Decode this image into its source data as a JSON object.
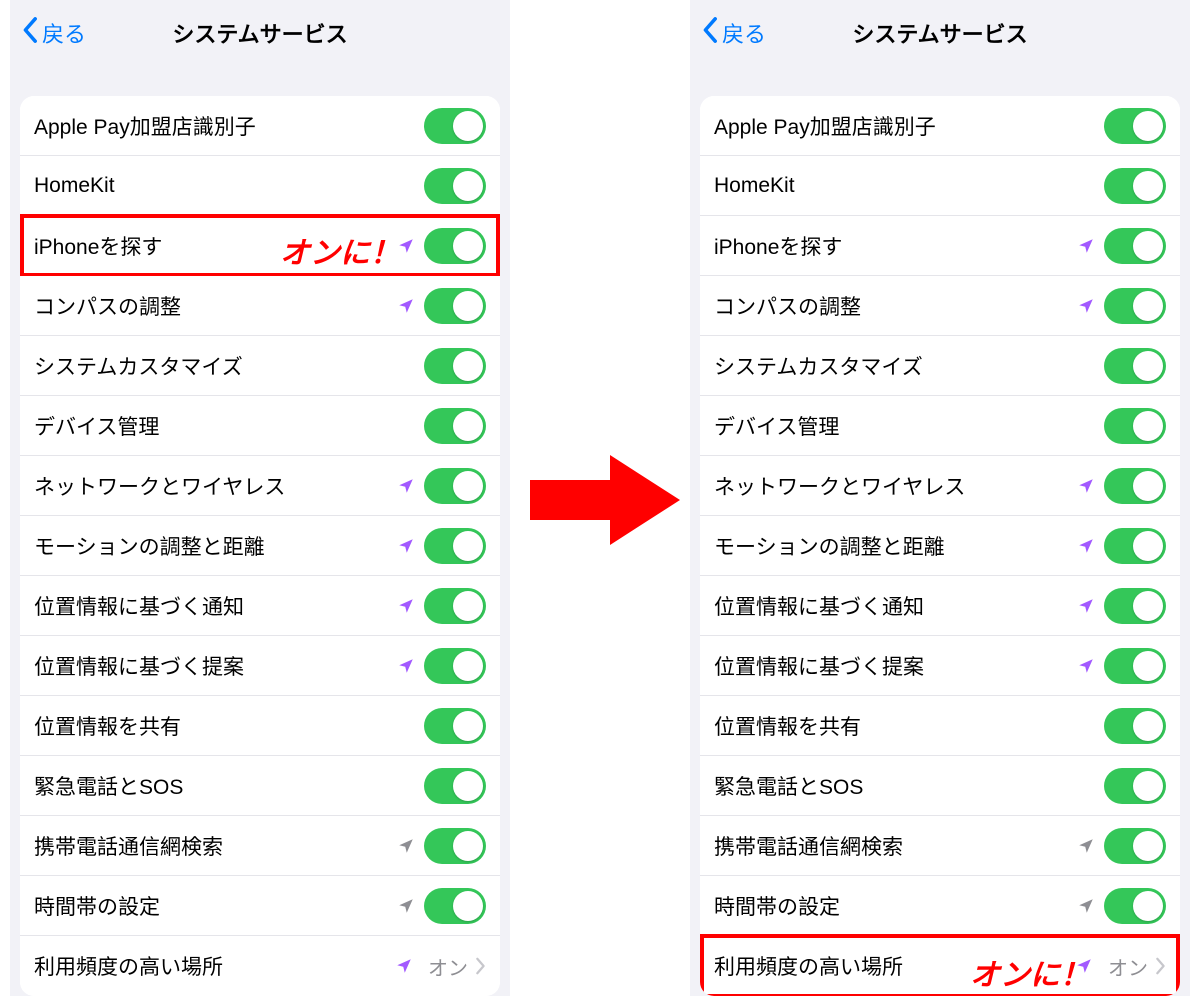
{
  "nav": {
    "back_label": "戻る",
    "title": "システムサービス"
  },
  "callouts": {
    "on_text": "オンに！"
  },
  "rows": [
    {
      "label": "Apple Pay加盟店識別子",
      "indicator": "none",
      "type": "toggle",
      "on": true
    },
    {
      "label": "HomeKit",
      "indicator": "none",
      "type": "toggle",
      "on": true
    },
    {
      "label": "iPhoneを探す",
      "indicator": "purple",
      "type": "toggle",
      "on": true,
      "highlight_left": true
    },
    {
      "label": "コンパスの調整",
      "indicator": "purple",
      "type": "toggle",
      "on": true
    },
    {
      "label": "システムカスタマイズ",
      "indicator": "none",
      "type": "toggle",
      "on": true
    },
    {
      "label": "デバイス管理",
      "indicator": "none",
      "type": "toggle",
      "on": true
    },
    {
      "label": "ネットワークとワイヤレス",
      "indicator": "purple",
      "type": "toggle",
      "on": true
    },
    {
      "label": "モーションの調整と距離",
      "indicator": "purple",
      "type": "toggle",
      "on": true
    },
    {
      "label": "位置情報に基づく通知",
      "indicator": "purple",
      "type": "toggle",
      "on": true
    },
    {
      "label": "位置情報に基づく提案",
      "indicator": "purple",
      "type": "toggle",
      "on": true
    },
    {
      "label": "位置情報を共有",
      "indicator": "none",
      "type": "toggle",
      "on": true
    },
    {
      "label": "緊急電話とSOS",
      "indicator": "none",
      "type": "toggle",
      "on": true
    },
    {
      "label": "携帯電話通信網検索",
      "indicator": "gray",
      "type": "toggle",
      "on": true
    },
    {
      "label": "時間帯の設定",
      "indicator": "gray",
      "type": "toggle",
      "on": true
    },
    {
      "label": "利用頻度の高い場所",
      "indicator": "purple",
      "type": "link",
      "value": "オン",
      "highlight_right": true
    }
  ]
}
